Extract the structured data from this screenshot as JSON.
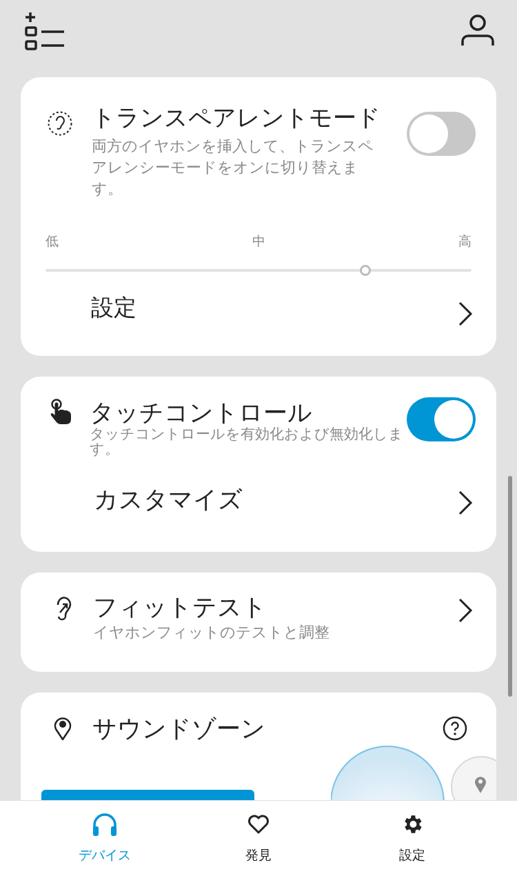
{
  "transparent_mode": {
    "title": "トランスペアレントモード",
    "description": "両方のイヤホンを挿入して、トランスペアレンシーモードをオンに切り替えます。",
    "on": false,
    "slider": {
      "labels": [
        "低",
        "中",
        "高"
      ],
      "level": 0.75
    },
    "link": "設定"
  },
  "touch_control": {
    "title": "タッチコントロール",
    "description": "タッチコントロールを有効化および無効化します。",
    "on": true,
    "link": "カスタマイズ"
  },
  "fit_test": {
    "title": "フィットテスト",
    "description": "イヤホンフィットのテストと調整"
  },
  "sound_zone": {
    "title": "サウンドゾーン"
  },
  "bottom_nav": [
    {
      "kind": "devices",
      "label": "デバイス",
      "selected": true
    },
    {
      "kind": "discover",
      "label": "発見",
      "selected": false
    },
    {
      "kind": "settings",
      "label": "設定",
      "selected": false
    }
  ]
}
